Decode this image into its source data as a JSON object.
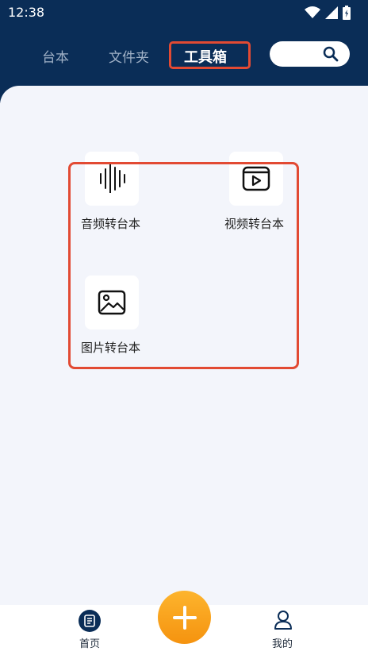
{
  "status_bar": {
    "time": "12:38"
  },
  "tabs": [
    {
      "label": "台本"
    },
    {
      "label": "文件夹"
    },
    {
      "label": "工具箱"
    }
  ],
  "tools": [
    {
      "label": "音频转台本",
      "icon": "audio-waveform-icon"
    },
    {
      "label": "视频转台本",
      "icon": "video-player-icon"
    },
    {
      "label": "图片转台本",
      "icon": "image-icon"
    }
  ],
  "bottom_nav": {
    "home_label": "首页",
    "mine_label": "我的"
  },
  "colors": {
    "header_bg": "#0a2d57",
    "content_bg": "#f3f5fb",
    "highlight": "#e24a33",
    "fab": "#f7a21c"
  }
}
